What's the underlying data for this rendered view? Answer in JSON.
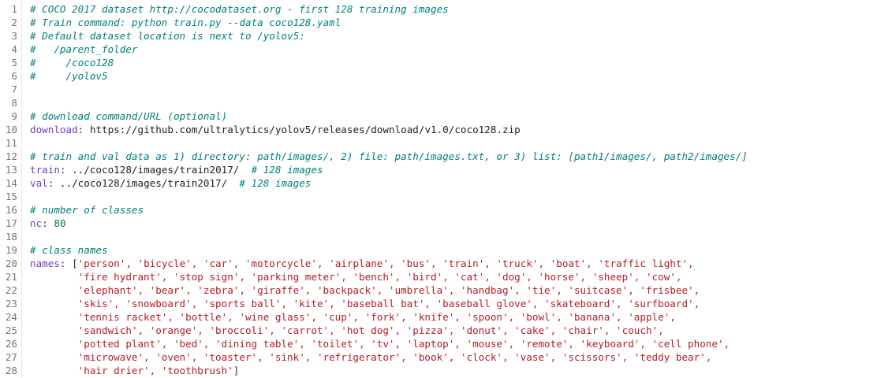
{
  "file": {
    "lines": [
      [
        {
          "t": "# COCO 2017 dataset http://cocodataset.org - first 128 training images",
          "c": "comment"
        }
      ],
      [
        {
          "t": "# Train command: python train.py --data coco128.yaml",
          "c": "comment"
        }
      ],
      [
        {
          "t": "# Default dataset location is next to /yolov5:",
          "c": "comment"
        }
      ],
      [
        {
          "t": "#   /parent_folder",
          "c": "comment"
        }
      ],
      [
        {
          "t": "#     /coco128",
          "c": "comment"
        }
      ],
      [
        {
          "t": "#     /yolov5",
          "c": "comment"
        }
      ],
      [],
      [],
      [
        {
          "t": "# download command/URL (optional)",
          "c": "comment"
        }
      ],
      [
        {
          "t": "download",
          "c": "key"
        },
        {
          "t": ": ",
          "c": "punct"
        },
        {
          "t": "https://github.com/ultralytics/yolov5/releases/download/v1.0/coco128.zip",
          "c": "plain"
        }
      ],
      [],
      [
        {
          "t": "# train and val data as 1) directory: path/images/, 2) file: path/images.txt, or 3) list: [path1/images/, path2/images/]",
          "c": "comment"
        }
      ],
      [
        {
          "t": "train",
          "c": "key"
        },
        {
          "t": ": ",
          "c": "punct"
        },
        {
          "t": "../coco128/images/train2017/  ",
          "c": "plain"
        },
        {
          "t": "# 128 images",
          "c": "comment"
        }
      ],
      [
        {
          "t": "val",
          "c": "key"
        },
        {
          "t": ": ",
          "c": "punct"
        },
        {
          "t": "../coco128/images/train2017/  ",
          "c": "plain"
        },
        {
          "t": "# 128 images",
          "c": "comment"
        }
      ],
      [],
      [
        {
          "t": "# number of classes",
          "c": "comment"
        }
      ],
      [
        {
          "t": "nc",
          "c": "key"
        },
        {
          "t": ": ",
          "c": "punct"
        },
        {
          "t": "80",
          "c": "num"
        }
      ],
      [],
      [
        {
          "t": "# class names",
          "c": "comment"
        }
      ],
      [
        {
          "t": "names",
          "c": "key"
        },
        {
          "t": ": [",
          "c": "punct"
        },
        {
          "t": "'person', 'bicycle', 'car', 'motorcycle', 'airplane', 'bus', 'train', 'truck', 'boat', 'traffic light',",
          "c": "str"
        }
      ],
      [
        {
          "t": "        'fire hydrant', 'stop sign', 'parking meter', 'bench', 'bird', 'cat', 'dog', 'horse', 'sheep', 'cow',",
          "c": "str"
        }
      ],
      [
        {
          "t": "        'elephant', 'bear', 'zebra', 'giraffe', 'backpack', 'umbrella', 'handbag', 'tie', 'suitcase', 'frisbee',",
          "c": "str"
        }
      ],
      [
        {
          "t": "        'skis', 'snowboard', 'sports ball', 'kite', 'baseball bat', 'baseball glove', 'skateboard', 'surfboard',",
          "c": "str"
        }
      ],
      [
        {
          "t": "        'tennis racket', 'bottle', 'wine glass', 'cup', 'fork', 'knife', 'spoon', 'bowl', 'banana', 'apple',",
          "c": "str"
        }
      ],
      [
        {
          "t": "        'sandwich', 'orange', 'broccoli', 'carrot', 'hot dog', 'pizza', 'donut', 'cake', 'chair', 'couch',",
          "c": "str"
        }
      ],
      [
        {
          "t": "        'potted plant', 'bed', 'dining table', 'toilet', 'tv', 'laptop', 'mouse', 'remote', 'keyboard', 'cell phone',",
          "c": "str"
        }
      ],
      [
        {
          "t": "        'microwave', 'oven', 'toaster', 'sink', 'refrigerator', 'book', 'clock', 'vase', 'scissors', 'teddy bear',",
          "c": "str"
        }
      ],
      [
        {
          "t": "        'hair drier', 'toothbrush'",
          "c": "str"
        },
        {
          "t": "]",
          "c": "punct"
        }
      ]
    ]
  }
}
